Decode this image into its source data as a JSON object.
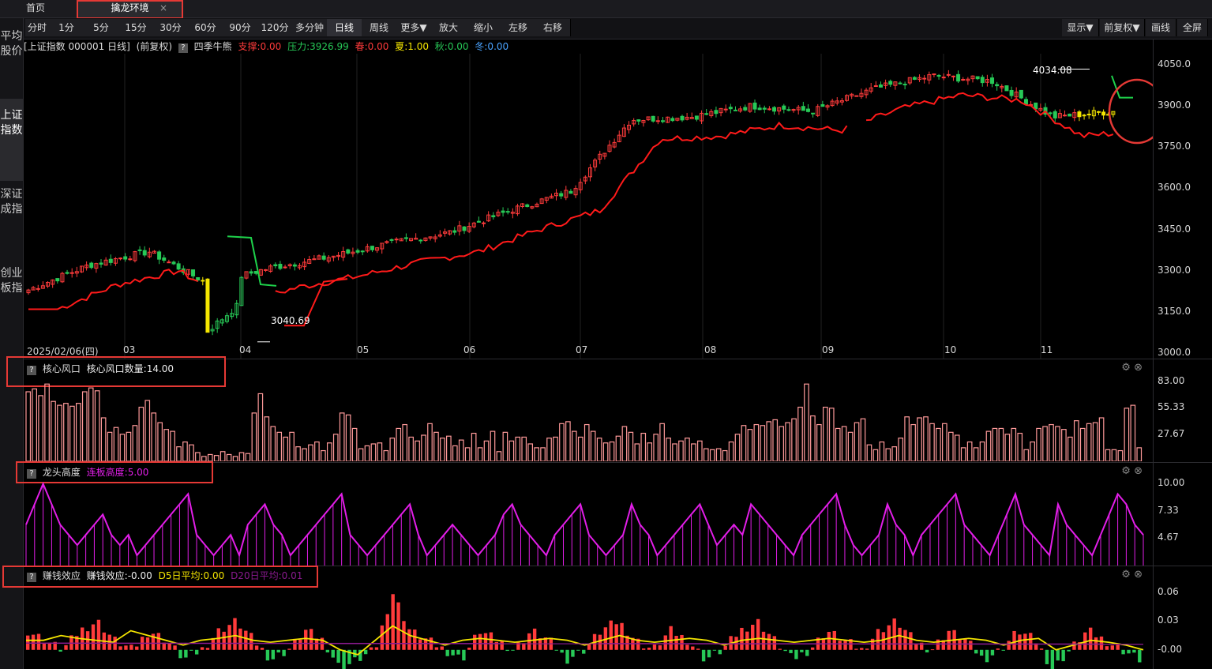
{
  "tabs": {
    "home": "首页",
    "env": "擒龙环境",
    "close": "×"
  },
  "sidebar": [
    "平均股价",
    "上证指数",
    "深证成指",
    "创业板指"
  ],
  "toolbar": {
    "left": [
      "分时",
      "1分",
      "5分",
      "15分",
      "30分",
      "60分",
      "90分",
      "120分",
      "多分钟",
      "日线",
      "周线",
      "更多▼",
      "放大",
      "缩小",
      "左移",
      "右移"
    ],
    "active": "日线",
    "right": [
      "显示▼",
      "前复权▼",
      "画线",
      "全屏"
    ]
  },
  "infobar": {
    "title": "[上证指数 000001 日线]",
    "adj": "(前复权)",
    "indicator": "四季牛熊",
    "support": "支撑:0.00",
    "pressure": "压力:3926.99",
    "spring": "春:0.00",
    "summer": "夏:1.00",
    "autumn": "秋:0.00",
    "winter": "冬:0.00"
  },
  "main": {
    "y_ticks": [
      "4050.0",
      "3900.0",
      "3750.0",
      "3600.0",
      "3450.0",
      "3300.0",
      "3150.0",
      "3000.0"
    ],
    "dates": [
      "2025/02/06(四)",
      "03",
      "04",
      "05",
      "06",
      "07",
      "08",
      "09",
      "10",
      "11"
    ],
    "high_label": "4034.08",
    "low_label": "3040.69"
  },
  "panel1": {
    "title": "核心风口",
    "value": "核心风口数量:14.00",
    "y_ticks": [
      "83.00",
      "55.33",
      "27.67"
    ]
  },
  "panel2": {
    "title": "龙头高度",
    "value": "连板高度:5.00",
    "y_ticks": [
      "10.00",
      "7.33",
      "4.67"
    ]
  },
  "panel3": {
    "title": "赚钱效应",
    "value": "赚钱效应:-0.00",
    "d5": "D5日平均:0.00",
    "d20": "D20日平均:0.01",
    "y_ticks": [
      "0.06",
      "0.03",
      "-0.00"
    ]
  },
  "colors": {
    "up": "#ff3b3b",
    "down": "#27c957",
    "support": "#ff1a1a",
    "pressure": "#1ed24b",
    "magenta": "#e21ee8",
    "yellow": "#f5e600",
    "bar_pink": "#ff9a9a"
  },
  "chart_data": [
    {
      "type": "line",
      "title": "上证指数 000001 日线",
      "x": [
        "2025/02/06",
        "03",
        "04",
        "05",
        "06",
        "07",
        "08",
        "09",
        "10",
        "11"
      ],
      "series": [
        {
          "name": "上证指数",
          "values": [
            3230,
            3320,
            3370,
            3250,
            3310,
            3350,
            3400,
            3440,
            3520,
            3590,
            3850,
            3860,
            3900,
            3880,
            3960,
            4010,
            3990,
            3860,
            3880
          ]
        }
      ],
      "ylim": [
        2980,
        4090
      ]
    },
    {
      "type": "bar",
      "title": "核心风口",
      "series": [
        {
          "name": "核心风口数量",
          "values": [
            72,
            75,
            68,
            80,
            62,
            58,
            60,
            57,
            60,
            72,
            76,
            73,
            45,
            30,
            35,
            28,
            30,
            37,
            56,
            63,
            50,
            40,
            33,
            31,
            15,
            20,
            17,
            9,
            5,
            7,
            6,
            10,
            7,
            5,
            9,
            8,
            50,
            70,
            46,
            36,
            30,
            25,
            30,
            15,
            13,
            17,
            20,
            11,
            19,
            28,
            50,
            48,
            34,
            13,
            16,
            18,
            19,
            11,
            24,
            34,
            38,
            25,
            21,
            27,
            39,
            30,
            24,
            26,
            16,
            22,
            14,
            29,
            14,
            21,
            31,
            10,
            30,
            21,
            25,
            25,
            18,
            14,
            14,
            24,
            25,
            39,
            41,
            31,
            25,
            38,
            31,
            24,
            19,
            20,
            26,
            36,
            30,
            18,
            29,
            19,
            28,
            39,
            24,
            18,
            21,
            24,
            18,
            21,
            13,
            12,
            13,
            11,
            20,
            28,
            37,
            33,
            38,
            37,
            41,
            43,
            36,
            40,
            44,
            56,
            80,
            47,
            38,
            56,
            55,
            34,
            36,
            30,
            40,
            44,
            17,
            12,
            20,
            13,
            15,
            24,
            46,
            38,
            45,
            46,
            39,
            34,
            39,
            30,
            27,
            14,
            20,
            14,
            20,
            31,
            34,
            34,
            28,
            34,
            29,
            12,
            20,
            34,
            36,
            38,
            36,
            33,
            25,
            42,
            34,
            39,
            40,
            45,
            12,
            12,
            11,
            55,
            58,
            14
          ]
        }
      ]
    },
    {
      "type": "line",
      "title": "龙头高度",
      "series": [
        {
          "name": "连板高度",
          "values": [
            6,
            8,
            10,
            8,
            6,
            5,
            4,
            5,
            6,
            7,
            5,
            4,
            5,
            3,
            4,
            5,
            6,
            7,
            8,
            9,
            5,
            4,
            3,
            4,
            5,
            3,
            6,
            7,
            8,
            6,
            5,
            3,
            4,
            5,
            6,
            7,
            8,
            9,
            5,
            4,
            3,
            4,
            5,
            6,
            7,
            8,
            5,
            3,
            4,
            5,
            6,
            5,
            4,
            3,
            4,
            5,
            7,
            8,
            6,
            5,
            4,
            3,
            5,
            6,
            7,
            8,
            5,
            4,
            3,
            4,
            5,
            8,
            6,
            5,
            3,
            4,
            5,
            6,
            7,
            8,
            6,
            4,
            5,
            6,
            5,
            8,
            7,
            6,
            5,
            4,
            3,
            5,
            6,
            7,
            8,
            9,
            6,
            4,
            3,
            4,
            5,
            8,
            6,
            5,
            3,
            5,
            6,
            7,
            8,
            9,
            6,
            5,
            4,
            3,
            5,
            7,
            9,
            6,
            5,
            4,
            3,
            8,
            6,
            5,
            4,
            3,
            5,
            7,
            9,
            8,
            6,
            5
          ]
        }
      ]
    },
    {
      "type": "bar",
      "title": "赚钱效应",
      "series": [
        {
          "name": "赚钱效应",
          "values": [
            0.02,
            0.01,
            0.0,
            0.02,
            0.03,
            0.01,
            0.0,
            0.02,
            0.01,
            -0.01,
            0.0,
            0.02,
            0.03,
            0.01,
            -0.01,
            0.0,
            0.02,
            0.01,
            -0.02,
            -0.01,
            0.0,
            0.06,
            0.02,
            0.01,
            0.0,
            -0.01,
            0.02,
            0.01,
            0.0,
            0.02,
            0.01,
            -0.01,
            0.0,
            0.02,
            0.03,
            0.01,
            0.0,
            0.02,
            0.01,
            -0.01,
            0.0,
            0.02,
            0.03,
            0.01,
            -0.01,
            0.0,
            0.02,
            0.01,
            0.0,
            0.02,
            0.03,
            0.01,
            0.0,
            0.02,
            0.01,
            -0.01,
            0.0,
            0.02,
            0.01,
            -0.02,
            0.0,
            0.02,
            0.01,
            0.0,
            -0.01
          ]
        },
        {
          "name": "D5日平均",
          "values": [
            0.01,
            0.01,
            0.015,
            0.012,
            0.01,
            0.008,
            0.02,
            0.015,
            0.01,
            0.005,
            0.01,
            0.012,
            0.015,
            0.01,
            0.008,
            0.01,
            0.012,
            0.01,
            0.0,
            -0.005,
            0.01,
            0.025,
            0.015,
            0.01,
            0.005,
            0.01,
            0.012,
            0.01,
            0.008,
            0.01,
            0.012,
            0.01,
            0.005,
            0.01,
            0.015,
            0.01,
            0.008,
            0.01,
            0.012,
            0.01,
            0.005,
            0.01,
            0.012,
            0.01,
            0.008,
            0.01,
            0.012,
            0.01,
            0.008,
            0.01,
            0.015,
            0.01,
            0.008,
            0.01,
            0.012,
            0.01,
            0.005,
            0.01,
            0.012,
            0.0,
            0.005,
            0.01,
            0.008,
            0.005,
            0.0
          ]
        }
      ],
      "ylim": [
        -0.02,
        0.07
      ]
    }
  ]
}
